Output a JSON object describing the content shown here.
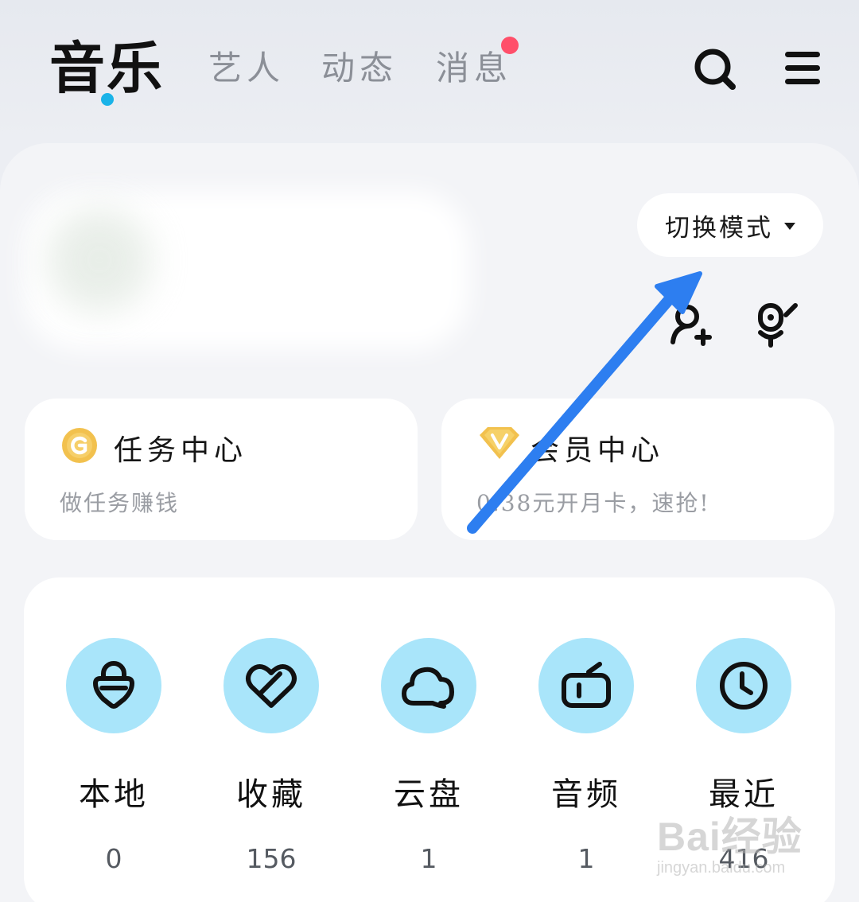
{
  "nav": {
    "tabs": [
      {
        "label": "音乐",
        "active": true
      },
      {
        "label": "艺人"
      },
      {
        "label": "动态"
      },
      {
        "label": "消息",
        "badge": "dot"
      }
    ],
    "actions": [
      "search-icon",
      "menu-icon"
    ],
    "accent_color": "#1ab3e8",
    "badge_color": "#ff4f6a"
  },
  "profile": {
    "switch_mode_label": "切换模式",
    "actions": [
      "add-friend-icon",
      "mic-icon"
    ]
  },
  "cards": {
    "task": {
      "title": "任务中心",
      "subtitle": "做任务赚钱",
      "icon": "coin-icon",
      "icon_color": "#f2c14e"
    },
    "vip": {
      "title": "会员中心",
      "subtitle": "0.38元开月卡，速抢!",
      "icon": "diamond-icon",
      "icon_color": "#f2c14e"
    }
  },
  "shortcuts": [
    {
      "label": "本地",
      "count": "0",
      "icon": "local-music-icon"
    },
    {
      "label": "收藏",
      "count": "156",
      "icon": "favorite-icon"
    },
    {
      "label": "云盘",
      "count": "1",
      "icon": "cloud-icon"
    },
    {
      "label": "音频",
      "count": "1",
      "icon": "radio-icon"
    },
    {
      "label": "最近",
      "count": "416",
      "icon": "clock-icon"
    }
  ],
  "shortcut_circle_color": "#a9e5fa",
  "annotation_color": "#2d7ef0",
  "watermark": {
    "main": "Bai经验",
    "sub": "jingyan.baidu.com"
  }
}
